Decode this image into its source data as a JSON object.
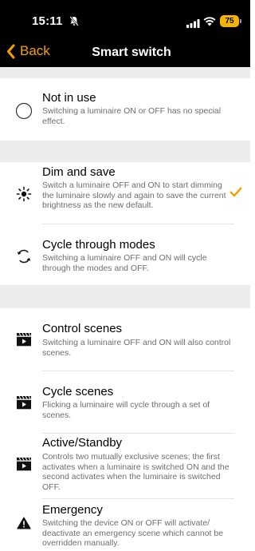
{
  "status_bar": {
    "time": "15:11",
    "battery": "75"
  },
  "nav": {
    "back_label": "Back",
    "title": "Smart switch"
  },
  "accent": "#f5a000",
  "options": [
    {
      "title": "Not in use",
      "description": "Switching a luminaire ON or OFF has no special effect.",
      "icon": "circle-icon",
      "selected": false
    },
    {
      "title": "Dim and save",
      "description": "Switch a luminaire OFF and ON to start dimming the luminaire slowly and again to save the current brightness as the new default.",
      "icon": "brightness-icon",
      "selected": true
    },
    {
      "title": "Cycle through modes",
      "description": "Switching a luminaire OFF and ON will cycle through the modes and OFF.",
      "icon": "cycle-icon",
      "selected": false
    },
    {
      "title": "Control scenes",
      "description": "Switching a luminaire OFF and ON will also control scenes.",
      "icon": "clapperboard-icon",
      "selected": false
    },
    {
      "title": "Cycle scenes",
      "description": "Flicking a luminaire will cycle through a set of scenes.",
      "icon": "clapperboard-icon",
      "selected": false
    },
    {
      "title": "Active/Standby",
      "description": "Controls two mutually exclusive scenes; the first activates when a luminaire is switched ON and the second activates when the luminaire is switched OFF.",
      "icon": "clapperboard-icon",
      "selected": false
    },
    {
      "title": "Emergency",
      "description": "Switching the device ON or OFF will activate/ deactivate an emergency scene which cannot be overridden manually.",
      "icon": "warning-icon",
      "selected": false
    }
  ]
}
